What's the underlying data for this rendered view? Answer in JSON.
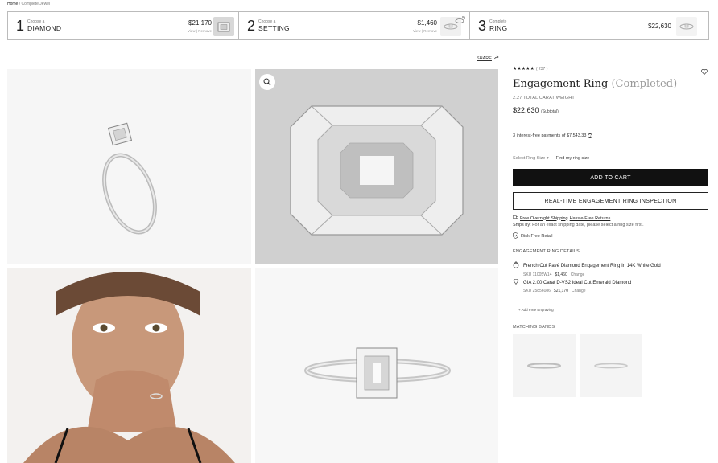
{
  "breadcrumb": {
    "home": "Home",
    "current": "Complete Jewel"
  },
  "steps": [
    {
      "num": "1",
      "small": "Choose a",
      "big": "DIAMOND",
      "price": "$21,170",
      "links": "View | Remove",
      "thumb": "emerald-diamond-thumbnail"
    },
    {
      "num": "2",
      "small": "Choose a",
      "big": "SETTING",
      "price": "$1,460",
      "links": "View | Remove",
      "thumb": "ring-setting-thumbnail"
    },
    {
      "num": "3",
      "small": "Complete",
      "big": "RING",
      "price": "$22,630",
      "thumb": "completed-ring-thumbnail"
    }
  ],
  "share": {
    "label": "SHARE"
  },
  "gallery": [
    {
      "name": "ring-angled-view",
      "icon": "ring-image"
    },
    {
      "name": "diamond-closeup",
      "icon": "emerald-diamond-image"
    },
    {
      "name": "model-wearing-ring",
      "icon": "model-photo"
    },
    {
      "name": "ring-front-view",
      "icon": "ring-image"
    }
  ],
  "product": {
    "stars": "★★★★★",
    "review_count": "( 237 )",
    "title": "Engagement Ring",
    "title_sub": "(Completed)",
    "carat_weight": "2.27 TOTAL CARAT WEIGHT",
    "price": "$22,630",
    "price_note": "(Subtotal)",
    "installments": "3 interest-free payments of $7,543.33",
    "ring_size_select": "Select Ring Size",
    "find_ring_size": "Find my ring size",
    "add_to_cart": "ADD TO CART",
    "inspection": "REAL-TIME ENGAGEMENT RING INSPECTION",
    "shipping_free": "Free Overnight Shipping",
    "returns": "Hassle-Free Returns",
    "ships_by_label": "Ships by:",
    "ships_by_text": "For an exact shipping date, please select a ring size first.",
    "risk_free": "Risk-Free Retail"
  },
  "details": {
    "heading": "ENGAGEMENT RING DETAILS",
    "items": [
      {
        "name": "French Cut Pavé Diamond Engagement Ring In 14K White Gold",
        "sku": "SKU 11005W14",
        "price": "$1,460",
        "change": "Change"
      },
      {
        "name": "GIA 2.00 Carat D-VS2 Ideal Cut Emerald Diamond",
        "sku": "SKU 25856086",
        "price": "$21,170",
        "change": "Change"
      }
    ],
    "engraving": "+ Add Free Engraving"
  },
  "matching_bands": {
    "heading": "MATCHING BANDS"
  },
  "colors": {
    "accent": "#111111",
    "border": "#bbbbbb"
  }
}
